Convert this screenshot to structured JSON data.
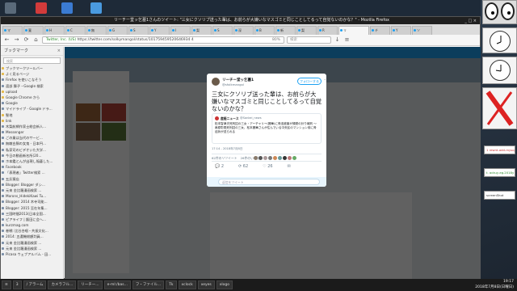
{
  "window": {
    "title": "リーチー堂ッ乞墓1さんのツイート: \"三女にクソリプ送った輩は、お前らが大嫌いなマスゴミと同じことしてるって自覚ないのかな？\" - Mozilla Firefox",
    "controls": "_ □ ×"
  },
  "tabs": [
    "マ",
    "寛",
    "H",
    "C",
    "無",
    "G",
    "S",
    "Y",
    "I",
    "梨",
    "S",
    "深",
    "B",
    "新",
    "梨",
    "R",
    "チ",
    "Y",
    "ソ"
  ],
  "active_tab": "リ",
  "nav": {
    "url": "https://twitter.com/solkymangol/status/101759459520646934 4",
    "url_prefix": "Twitter, Inc. (US)",
    "zoom": "80%",
    "search_placeholder": "検索"
  },
  "sidebar": {
    "title": "ブックマーク",
    "search_placeholder": "検索",
    "items": [
      {
        "label": "ブックマークツールバー",
        "folder": true
      },
      {
        "label": "よく見るページ",
        "folder": true
      },
      {
        "label": "Firefox を使いこなそう",
        "folder": false
      },
      {
        "label": "渡部 舞子・Google 検索",
        "folder": false
      },
      {
        "label": "upload",
        "folder": true
      },
      {
        "label": "Google Chrome から",
        "folder": true
      },
      {
        "label": "Google",
        "folder": false
      },
      {
        "label": "マイドライブ - Google ドラ...",
        "folder": false
      },
      {
        "label": "聖地",
        "folder": true
      },
      {
        "label": "link",
        "folder": true
      },
      {
        "label": "木梨航網作家士総会新人...",
        "folder": false
      },
      {
        "label": "Messenger",
        "folder": false
      },
      {
        "label": "ごの業は当代のサービ...",
        "folder": false
      },
      {
        "label": "無敵白胴の女鬼 - 日本円...",
        "folder": false
      },
      {
        "label": "私家司のビデオいた大学...",
        "folder": false
      },
      {
        "label": "今日の動画新名所(20...",
        "folder": false
      },
      {
        "label": "ホ本鑑とんが出現し陥藝した...",
        "folder": false
      },
      {
        "label": "Facebook",
        "folder": false
      },
      {
        "label": "「表現者」Twitter検索 ...",
        "folder": false
      },
      {
        "label": "五反猿店",
        "folder": false
      },
      {
        "label": "Blogger: Blogger ダシ...",
        "folder": false
      },
      {
        "label": "元来 金比羅漫画検索 ...",
        "folder": false
      },
      {
        "label": "Morons_HidekiKawi Tu...",
        "folder": false
      },
      {
        "label": "Blogger: 2014 木寺司能...",
        "folder": false
      },
      {
        "label": "Blogger: 2015 至在年集...",
        "folder": false
      },
      {
        "label": "三国時間2013(日本全国...",
        "folder": false
      },
      {
        "label": "ピアライフ | 飯田に会へ...",
        "folder": false
      },
      {
        "label": "kurzmag.com",
        "folder": false
      },
      {
        "label": "巻戦: 比谷合唱・共振文化...",
        "folder": false
      },
      {
        "label": "2014: 五選機総額判員...",
        "folder": false
      },
      {
        "label": "元来 金比羅漫画検索 ...",
        "folder": false
      },
      {
        "label": "元来 金比羅漫画検索 ...",
        "folder": false
      },
      {
        "label": "Picasa ウェブアルバム - 田...",
        "folder": false
      }
    ]
  },
  "tweet": {
    "name": "リーチー堂ッ乞墓1",
    "handle": "@sfolkmangol",
    "follow_label": "フォローする",
    "text": "三女にクソリプ送った輩は、お前らが大嫌いなマスゴミと同じことしてるって自覚ないのかな？",
    "quote_name": "産経ニュース",
    "quote_handle": "@Sankei_news",
    "quote_body": "松本智津夫死刑囚の三女・アーチャリー(麗華)に脅迫被害が頻発の計り報判 〜麻原彰晃死刑囚の三女、松本麗華さんが住んでいる中央区のマンション前に脅迫状が送られる",
    "timestamp": "17:14 - 2018年7月8日",
    "retweets": "62件のリツイート",
    "likes": "26件のいいね",
    "actions": [
      "💬 2",
      "⟳ 62",
      "♡ 26",
      "✉"
    ],
    "reply_placeholder": "返信をツイート"
  },
  "taskbar": {
    "items": [
      "≡",
      "3",
      "/ アラーム",
      "カメラフル...",
      "リーチー...",
      "e-ml:/bas...",
      "フ・ファイル...",
      "Tk",
      "xclock",
      "xeyes",
      "xlogo"
    ],
    "time": "19:17",
    "date": "2018年7月8日(日曜日)"
  },
  "right_widgets": {
    "mini1": "1 rewrd-add-mysql-unq.rl",
    "mini2": "t. ackuy-eg.2018y 2018/7/",
    "mini3": "screenShot"
  }
}
